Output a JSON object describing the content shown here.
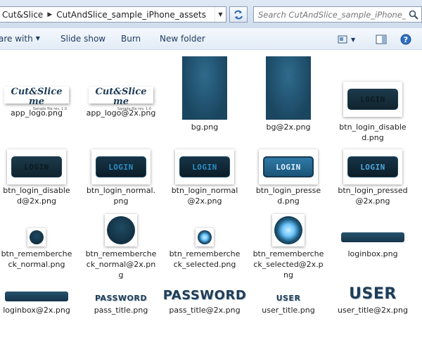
{
  "address_bar": {
    "crumbs": [
      "Cut&Slice",
      "CutAndSlice_sample_iPhone_assets"
    ],
    "search_placeholder": "Search CutAndSlice_sample_iPhone_a..."
  },
  "commands": {
    "share": "are with",
    "slideshow": "Slide show",
    "burn": "Burn",
    "new_folder": "New folder"
  },
  "thumb_text": {
    "logo": "Cut&Slice me",
    "logo_sub": "Sample file rev. 1.0",
    "login": "LOGIN",
    "password": "PASSWORD",
    "user": "USER"
  },
  "files": [
    "app_logo.png",
    "app_logo@2x.png",
    "bg.png",
    "bg@2x.png",
    "btn_login_disabled.png",
    "btn_login_disabled@2x.png",
    "btn_login_normal.png",
    "btn_login_normal@2x.png",
    "btn_login_pressed.png",
    "btn_login_pressed@2x.png",
    "btn_remembercheck_normal.png",
    "btn_remembercheck_normal@2x.png",
    "btn_remembercheck_selected.png",
    "btn_remembercheck_selected@2x.png",
    "loginbox.png",
    "loginbox@2x.png",
    "pass_title.png",
    "pass_title@2x.png",
    "user_title.png",
    "user_title@2x.png"
  ]
}
